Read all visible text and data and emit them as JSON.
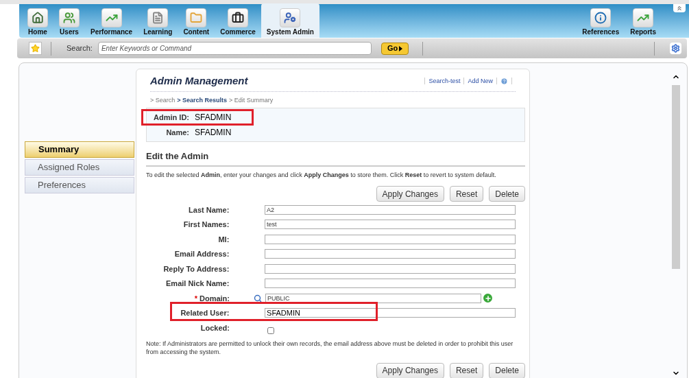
{
  "nav": {
    "items": [
      {
        "label": "Home",
        "selected": false
      },
      {
        "label": "Users",
        "selected": false
      },
      {
        "label": "Performance",
        "selected": false
      },
      {
        "label": "Learning",
        "selected": false
      },
      {
        "label": "Content",
        "selected": false
      },
      {
        "label": "Commerce",
        "selected": false
      },
      {
        "label": "System Admin",
        "selected": true
      }
    ],
    "right_items": [
      {
        "label": "References",
        "selected": false
      },
      {
        "label": "Reports",
        "selected": false
      }
    ]
  },
  "toolbar": {
    "search_label": "Search:",
    "search_placeholder": "Enter Keywords or Command",
    "go_button": "Go"
  },
  "sidebar": {
    "items": [
      {
        "label": "Summary",
        "selected": true
      },
      {
        "label": "Assigned Roles",
        "selected": false
      },
      {
        "label": "Preferences",
        "selected": false
      }
    ]
  },
  "page": {
    "title": "Admin Management",
    "links": [
      "Search-test",
      "Add New"
    ],
    "breadcrumb": [
      {
        "label": "> Search",
        "link": false
      },
      {
        "label": "> Search Results",
        "link": true
      },
      {
        "label": "> Edit Summary",
        "link": false
      }
    ],
    "summary": [
      {
        "label": "Admin ID:",
        "value": "SFADMIN",
        "highlighted": true
      },
      {
        "label": "Name:",
        "value": "SFADMIN",
        "highlighted": false
      }
    ],
    "section_title": "Edit the Admin",
    "intro": "To edit the selected **Admin**, enter your changes and click **Apply Changes** to store them. Click **Reset** to revert to system default.",
    "buttons": [
      "Apply Changes",
      "Reset",
      "Delete"
    ],
    "fields": [
      {
        "label": "Last Name:",
        "kind": "text",
        "value": "A2",
        "required": false,
        "highlighted": false
      },
      {
        "label": "First Names:",
        "kind": "text",
        "value": "test",
        "required": false,
        "highlighted": false
      },
      {
        "label": "MI:",
        "kind": "text",
        "required": false,
        "highlighted": false
      },
      {
        "label": "Email Address:",
        "kind": "text",
        "required": false,
        "highlighted": false
      },
      {
        "label": "Reply To Address:",
        "kind": "text",
        "required": false,
        "highlighted": false
      },
      {
        "label": "Email Nick Name:",
        "kind": "text",
        "required": false,
        "highlighted": false
      },
      {
        "label": "Domain:",
        "kind": "lookup",
        "value": "PUBLIC",
        "required": true,
        "highlighted": false
      },
      {
        "label": "Related User:",
        "kind": "text",
        "value": "SFADMIN",
        "required": false,
        "highlighted": true
      },
      {
        "label": "Locked:",
        "kind": "checkbox",
        "checked": false,
        "required": false,
        "highlighted": false
      }
    ],
    "required_mark": "*",
    "note": "Note: If Administrators are permitted to unlock their own records, the email address above must be deleted in order to prohibit this user from accessing the system.",
    "bottom_buttons": [
      "Apply Changes",
      "Reset",
      "Delete"
    ]
  }
}
